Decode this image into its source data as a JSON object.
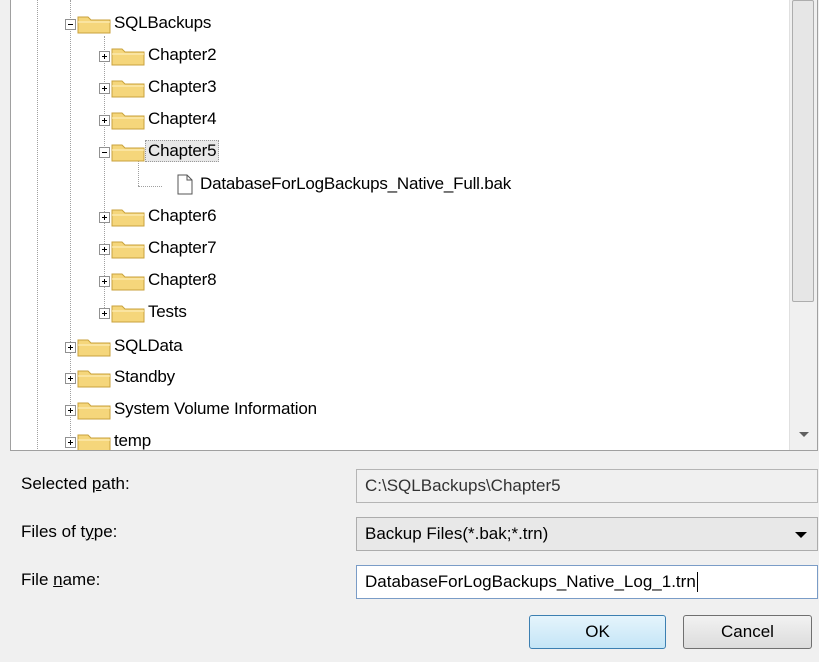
{
  "tree": {
    "items": [
      {
        "label": "SQLBackups",
        "icon": "folder-open-icon",
        "expander": "minus"
      },
      {
        "label": "Chapter2",
        "icon": "folder-icon",
        "expander": "plus"
      },
      {
        "label": "Chapter3",
        "icon": "folder-icon",
        "expander": "plus"
      },
      {
        "label": "Chapter4",
        "icon": "folder-icon",
        "expander": "plus"
      },
      {
        "label": "Chapter5",
        "icon": "folder-open-icon",
        "expander": "minus",
        "selected": true
      },
      {
        "label": "DatabaseForLogBackups_Native_Full.bak",
        "icon": "file-icon"
      },
      {
        "label": "Chapter6",
        "icon": "folder-icon",
        "expander": "plus"
      },
      {
        "label": "Chapter7",
        "icon": "folder-icon",
        "expander": "plus"
      },
      {
        "label": "Chapter8",
        "icon": "folder-icon",
        "expander": "plus"
      },
      {
        "label": "Tests",
        "icon": "folder-icon",
        "expander": "plus"
      },
      {
        "label": "SQLData",
        "icon": "folder-icon",
        "expander": "plus"
      },
      {
        "label": "Standby",
        "icon": "folder-icon",
        "expander": "plus"
      },
      {
        "label": "System Volume Information",
        "icon": "folder-icon",
        "expander": "plus"
      },
      {
        "label": "temp",
        "icon": "folder-icon",
        "expander": "plus"
      }
    ]
  },
  "form": {
    "selected_path_label_pre": "Selected ",
    "selected_path_label_ul": "p",
    "selected_path_label_post": "ath:",
    "selected_path_value": "C:\\SQLBackups\\Chapter5",
    "files_of_type_label_pre": "Files of t",
    "files_of_type_label_ul": "y",
    "files_of_type_label_post": "pe:",
    "files_of_type_value": "Backup Files(*.bak;*.trn)",
    "file_name_label_pre": "File ",
    "file_name_label_ul": "n",
    "file_name_label_post": "ame:",
    "file_name_value": "DatabaseForLogBackups_Native_Log_1.trn"
  },
  "buttons": {
    "ok": "OK",
    "cancel": "Cancel"
  },
  "colors": {
    "folder": "#f5d67b",
    "selection": "#e8e8e8",
    "ok_border": "#3c7fb1"
  }
}
